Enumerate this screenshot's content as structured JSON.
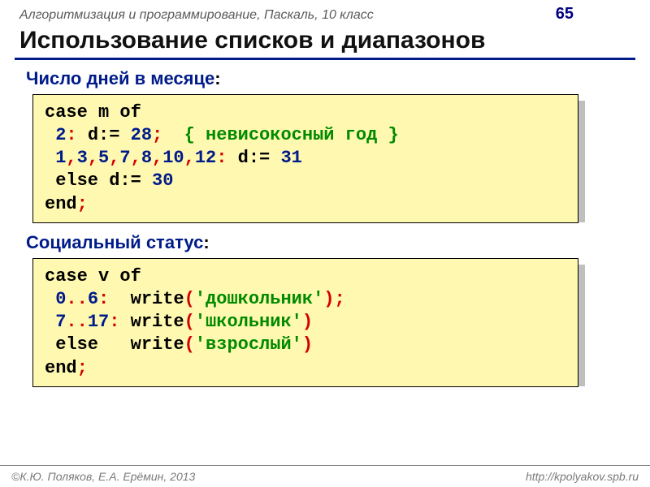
{
  "header": {
    "breadcrumb": "Алгоритмизация и программирование, Паскаль, 10 класс",
    "page_number": "65"
  },
  "title": "Использование списков и диапазонов",
  "sections": [
    {
      "label": "Число дней в месяце",
      "code_kind": "days"
    },
    {
      "label": "Социальный статус",
      "code_kind": "status"
    }
  ],
  "code": {
    "days": {
      "kw_case": "case",
      "var_m": "m",
      "kw_of": "of",
      "n2": "2",
      "var_d": "d",
      "asg": ":=",
      "n28": "28",
      "comment": "{ невисокосный год }",
      "list": [
        "1",
        "3",
        "5",
        "7",
        "8",
        "10",
        "12"
      ],
      "n31": "31",
      "kw_else": "else",
      "n30": "30",
      "kw_end": "end"
    },
    "status": {
      "kw_case": "case",
      "var_v": "v",
      "kw_of": "of",
      "r1a": "0",
      "r1b": "6",
      "fn_write": "write",
      "s1": "'дошкольник'",
      "r2a": "7",
      "r2b": "17",
      "s2": "'школьник'",
      "kw_else": "else",
      "s3": "'взрослый'",
      "kw_end": "end"
    }
  },
  "footer": {
    "left": "©К.Ю. Поляков, Е.А. Ерёмин, 2013",
    "right": "http://kpolyakov.spb.ru"
  }
}
